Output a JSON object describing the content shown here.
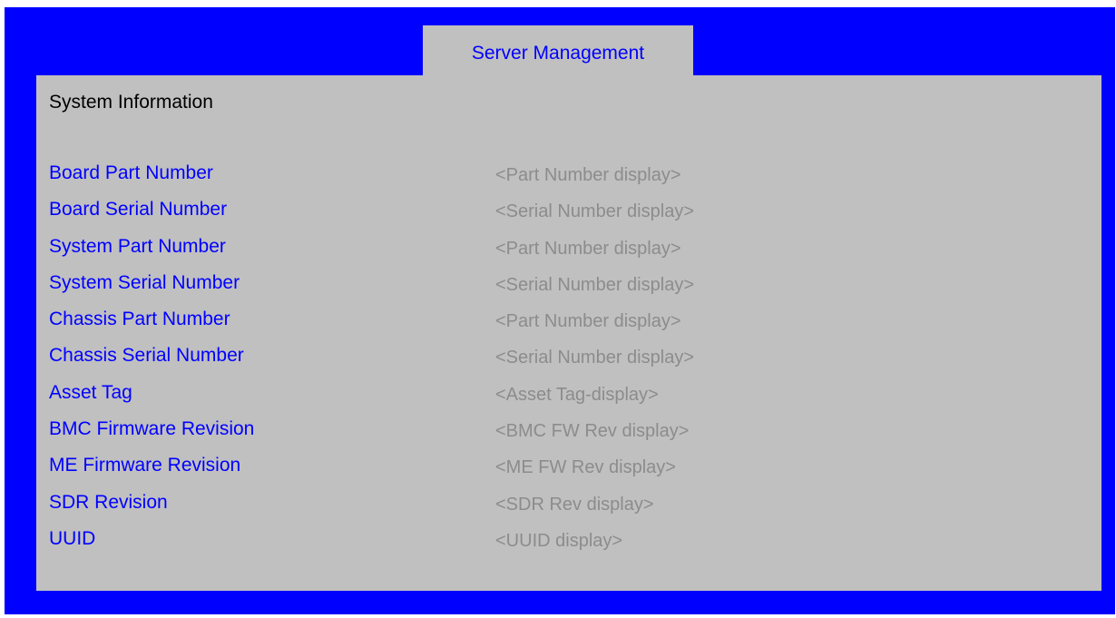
{
  "header": {
    "tab_label": "Server Management"
  },
  "section": {
    "title": "System Information"
  },
  "rows": [
    {
      "label": "Board Part Number",
      "value": "<Part Number display>"
    },
    {
      "label": "Board Serial Number",
      "value": "<Serial Number display>"
    },
    {
      "label": "System Part Number",
      "value": "<Part Number display>"
    },
    {
      "label": "System Serial Number",
      "value": "<Serial Number display>"
    },
    {
      "label": "Chassis Part Number",
      "value": "<Part Number display>"
    },
    {
      "label": "Chassis Serial Number",
      "value": "<Serial Number display>"
    },
    {
      "label": "Asset Tag",
      "value": "<Asset Tag-display>"
    },
    {
      "label": "BMC Firmware Revision",
      "value": "<BMC FW Rev display>"
    },
    {
      "label": "ME Firmware Revision",
      "value": "<ME FW Rev display>"
    },
    {
      "label": "SDR Revision",
      "value": "<SDR Rev display>"
    },
    {
      "label": "UUID",
      "value": "<UUID display>"
    }
  ],
  "colors": {
    "frame": "#0000ff",
    "panel": "#c0c0c0",
    "label": "#0000ff",
    "value": "#8c8c8c"
  }
}
